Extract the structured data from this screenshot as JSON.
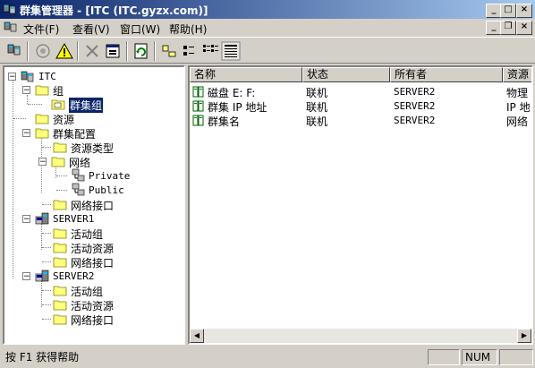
{
  "window": {
    "title": "群集管理器 - [ITC (ITC.gyzx.com)]"
  },
  "menu": {
    "items": [
      "文件(F)",
      "查看(V)",
      "窗口(W)",
      "帮助(H)"
    ]
  },
  "tree": {
    "root": "ITC",
    "groups": "组",
    "cluster_group": "群集组",
    "resources": "资源",
    "cluster_config": "群集配置",
    "resource_types": "资源类型",
    "networks": "网络",
    "private": "Private",
    "public": "Public",
    "net_interfaces": "网络接口",
    "server1": "SERVER1",
    "server2": "SERVER2",
    "active_groups": "活动组",
    "active_resources": "活动资源"
  },
  "list": {
    "columns": [
      "名称",
      "状态",
      "所有者",
      "资源"
    ],
    "rows": [
      {
        "name": "磁盘 E: F:",
        "status": "联机",
        "owner": "SERVER2",
        "type": "物理"
      },
      {
        "name": "群集 IP 地址",
        "status": "联机",
        "owner": "SERVER2",
        "type": "IP 地"
      },
      {
        "name": "群集名",
        "status": "联机",
        "owner": "SERVER2",
        "type": "网络"
      }
    ]
  },
  "status": {
    "help": "按 F1 获得帮助",
    "num": "NUM"
  }
}
